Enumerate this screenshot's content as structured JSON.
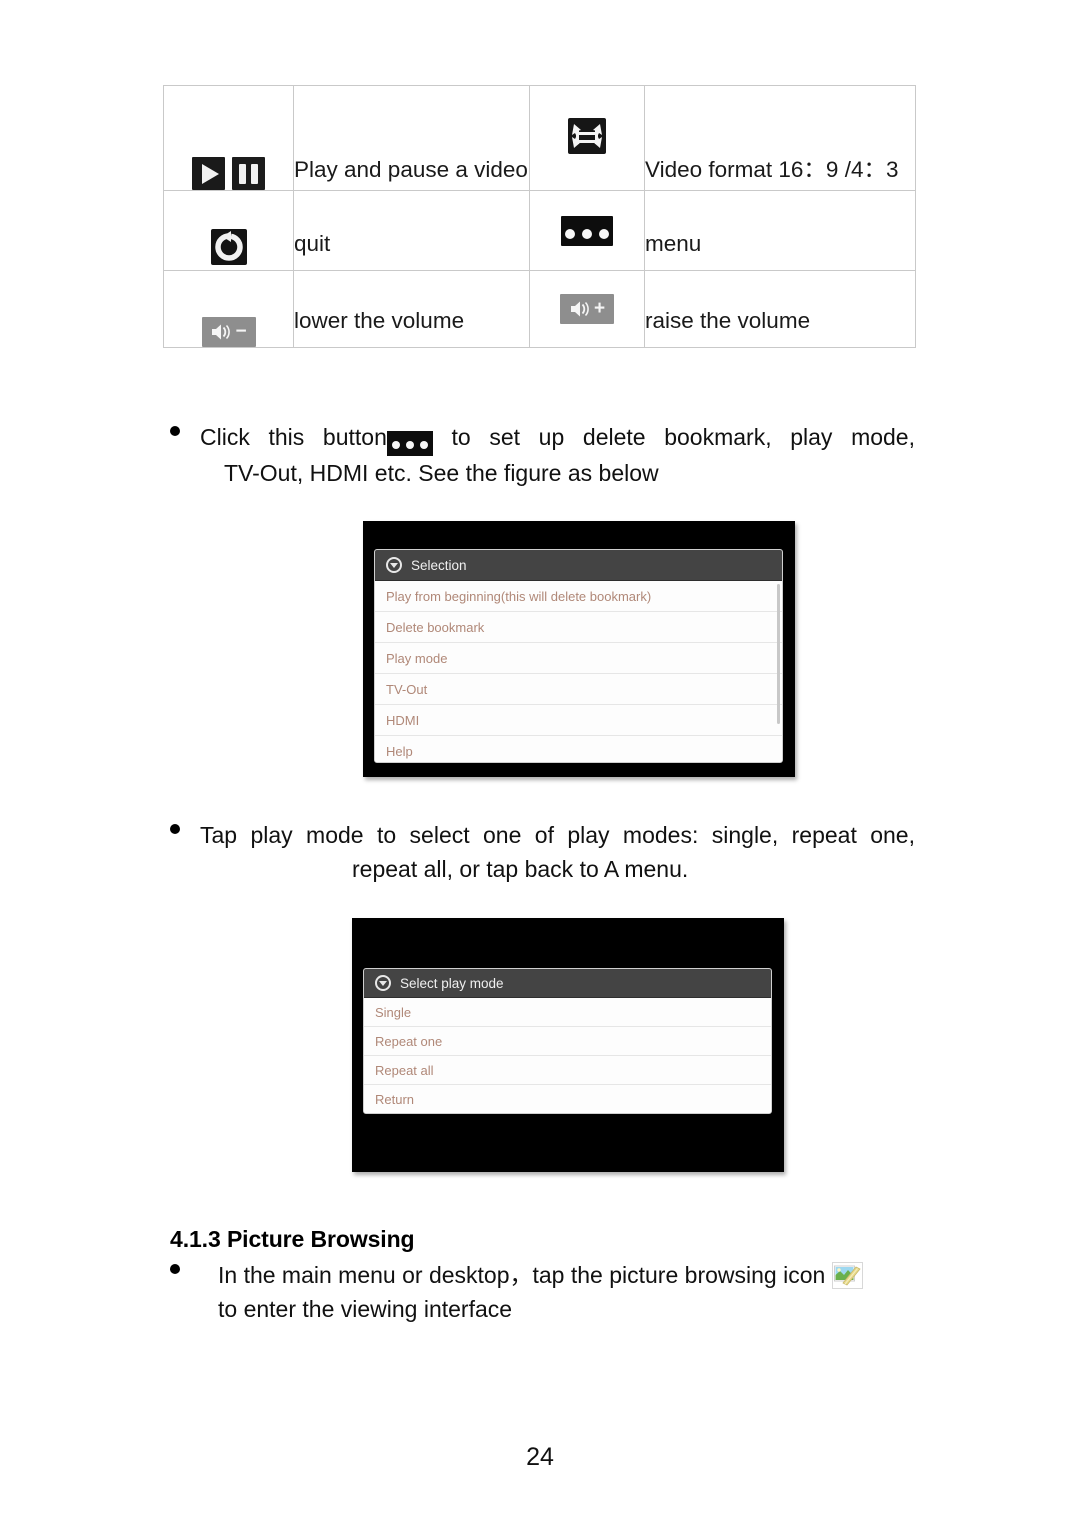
{
  "table": {
    "rows": [
      {
        "left_icon": "play-pause-icon",
        "left_text": "Play and pause a video",
        "right_icon": "video-format-icon",
        "right_text": "Video format 16：9 /4：3"
      },
      {
        "left_icon": "quit-icon",
        "left_text": "quit",
        "right_icon": "menu-dots-icon",
        "right_text": "menu"
      },
      {
        "left_icon": "volume-down-icon",
        "left_text": "lower the volume",
        "right_icon": "volume-up-icon",
        "right_text": "raise the volume"
      }
    ]
  },
  "bullet1": {
    "line1_a": "Click this button",
    "inline_icon": "menu-dots-icon",
    "line1_b": "to set up delete bookmark, play mode,",
    "line2": "TV-Out, HDMI etc. See the figure as below"
  },
  "selection_dialog": {
    "title": "Selection",
    "title_icon": "circle-chevron-down-icon",
    "items": [
      "Play from beginning(this will delete bookmark)",
      "Delete bookmark",
      "Play mode",
      "TV-Out",
      "HDMI",
      "Help"
    ]
  },
  "bullet2": {
    "line1": "Tap play mode to select one of play modes: single, repeat one,",
    "line2": "repeat all, or tap back to A menu."
  },
  "playmode_dialog": {
    "title": "Select play mode",
    "title_icon": "circle-chevron-down-icon",
    "items": [
      "Single",
      "Repeat one",
      "Repeat all",
      "Return"
    ]
  },
  "section": {
    "heading": "4.1.3 Picture Browsing",
    "bullet_line1": "In the main menu or desktop，tap the picture browsing icon",
    "bullet_icon": "picture-browsing-icon",
    "bullet_line2": "to enter the viewing interface"
  },
  "footer": {
    "page_number": "24"
  },
  "colors": {
    "dialog_title_bg": "#444444",
    "dialog_item_text": "#b08878",
    "screenshot_bg": "#000000",
    "table_border": "#c9c9c9"
  }
}
